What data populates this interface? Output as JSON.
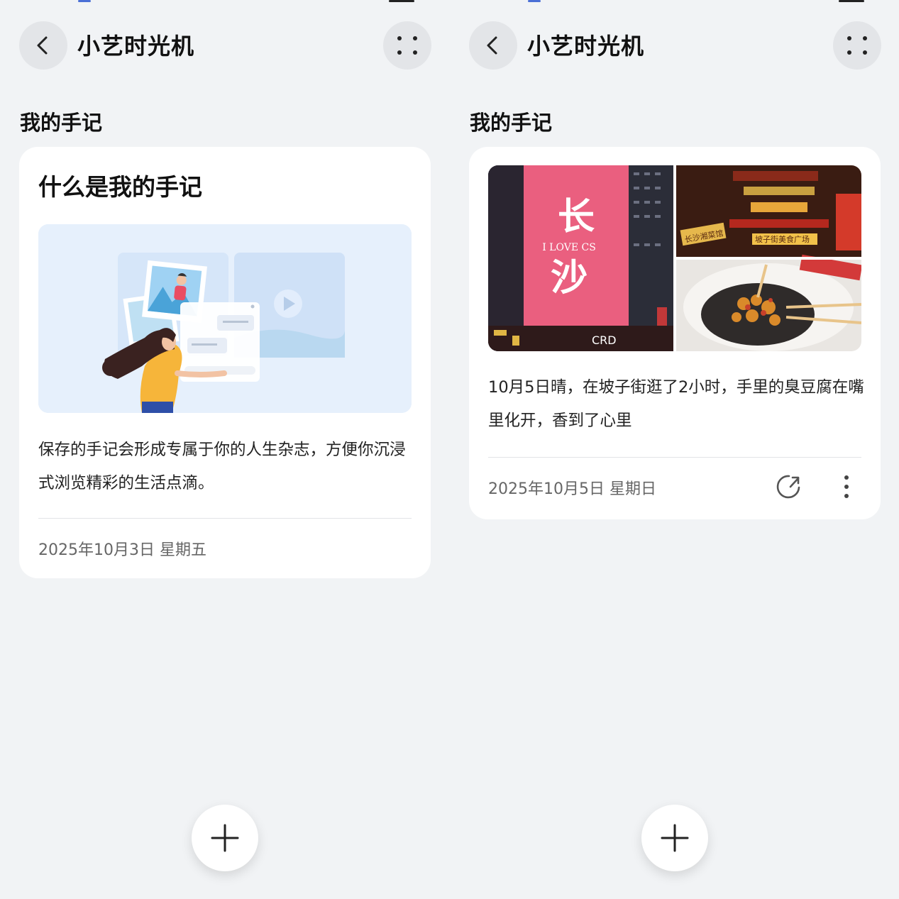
{
  "app": {
    "title": "小艺时光机"
  },
  "section": {
    "title": "我的手记"
  },
  "left_card": {
    "heading": "什么是我的手记",
    "description": "保存的手记会形成专属于你的人生杂志，方便你沉浸式浏览精彩的生活点滴。",
    "date": "2025年10月3日 星期五"
  },
  "right_card": {
    "note_text": "10月5日晴，在坡子街逛了2小时，手里的臭豆腐在嘴里化开，香到了心里",
    "date": "2025年10月5日 星期日",
    "photos": {
      "billboard_big_char_1": "长",
      "billboard_small_text": "I LOVE CS",
      "billboard_big_char_2": "沙",
      "billboard_bottom_text": "CRD",
      "street_sign": "坡子街美食广场",
      "street_sign_2": "长沙湘菜馆"
    }
  },
  "icons": {
    "back": "chevron-left-icon",
    "more": "four-dot-menu-icon",
    "share": "share-arrow-icon",
    "overflow": "vertical-ellipsis-icon",
    "add": "plus-icon"
  },
  "colors": {
    "background": "#f1f3f5",
    "card": "#ffffff",
    "billboard": "#ea5f7f",
    "button": "#e3e5e8"
  }
}
